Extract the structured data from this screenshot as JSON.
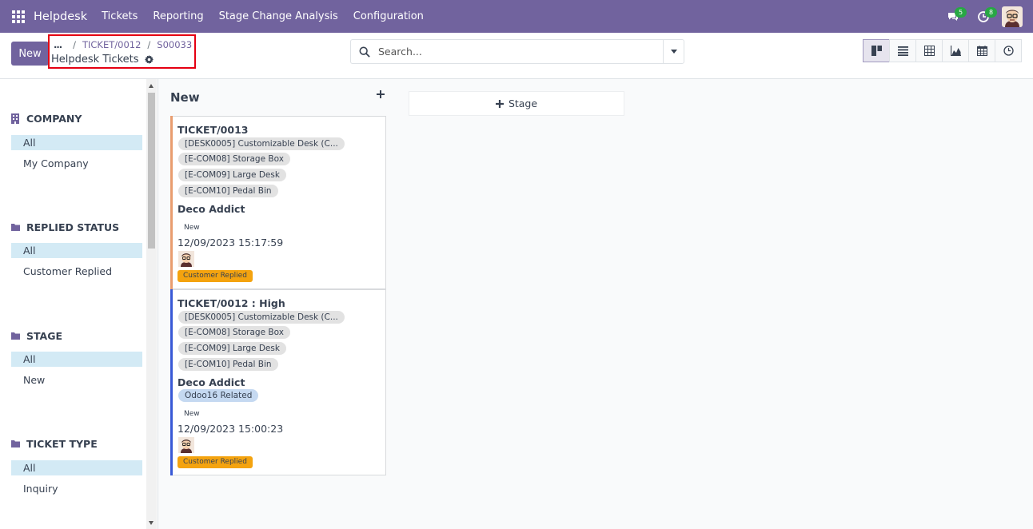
{
  "navbar": {
    "brand": "Helpdesk",
    "menu": [
      "Tickets",
      "Reporting",
      "Stage Change Analysis",
      "Configuration"
    ],
    "messages_count": "5",
    "activities_count": "8"
  },
  "control": {
    "new_label": "New",
    "breadcrumb": {
      "ellipsis": "...",
      "items": [
        "TICKET/0012",
        "S00033"
      ]
    },
    "page_title": "Helpdesk Tickets",
    "search_placeholder": "Search...",
    "views": [
      "kanban",
      "list",
      "pivot",
      "graph",
      "calendar",
      "activity"
    ],
    "active_view": "kanban"
  },
  "sidebar": {
    "sections": [
      {
        "icon": "building-icon",
        "title": "COMPANY",
        "items": [
          "All",
          "My Company"
        ]
      },
      {
        "icon": "folder-icon",
        "title": "REPLIED STATUS",
        "items": [
          "All",
          "Customer Replied"
        ]
      },
      {
        "icon": "folder-icon",
        "title": "STAGE",
        "items": [
          "All",
          "New"
        ]
      },
      {
        "icon": "folder-icon",
        "title": "TICKET TYPE",
        "items": [
          "All",
          "Inquiry"
        ]
      }
    ]
  },
  "kanban": {
    "column_title": "New",
    "add_stage_label": "Stage",
    "cards": [
      {
        "title": "TICKET/0013",
        "tags": [
          "[DESK0005] Customizable Desk (C...",
          "[E-COM08] Storage Box",
          "[E-COM09] Large Desk",
          "[E-COM10] Pedal Bin"
        ],
        "partner": "Deco Addict",
        "extra_tag": "",
        "stage": "New",
        "date": "12/09/2023 15:17:59",
        "status": "Customer Replied",
        "stripe_color": "#e99d6f"
      },
      {
        "title": "TICKET/0012 : High",
        "tags": [
          "[DESK0005] Customizable Desk (C...",
          "[E-COM08] Storage Box",
          "[E-COM09] Large Desk",
          "[E-COM10] Pedal Bin"
        ],
        "partner": "Deco Addict",
        "extra_tag": "Odoo16 Related",
        "stage": "New",
        "date": "12/09/2023 15:00:23",
        "status": "Customer Replied",
        "stripe_color": "#3959d6"
      }
    ]
  },
  "colors": {
    "navbar": "#71639e",
    "accent": "#71639e",
    "active_filter": "#d3eaf5",
    "status_badge": "#f4a30f",
    "badge_green": "#28a745"
  }
}
